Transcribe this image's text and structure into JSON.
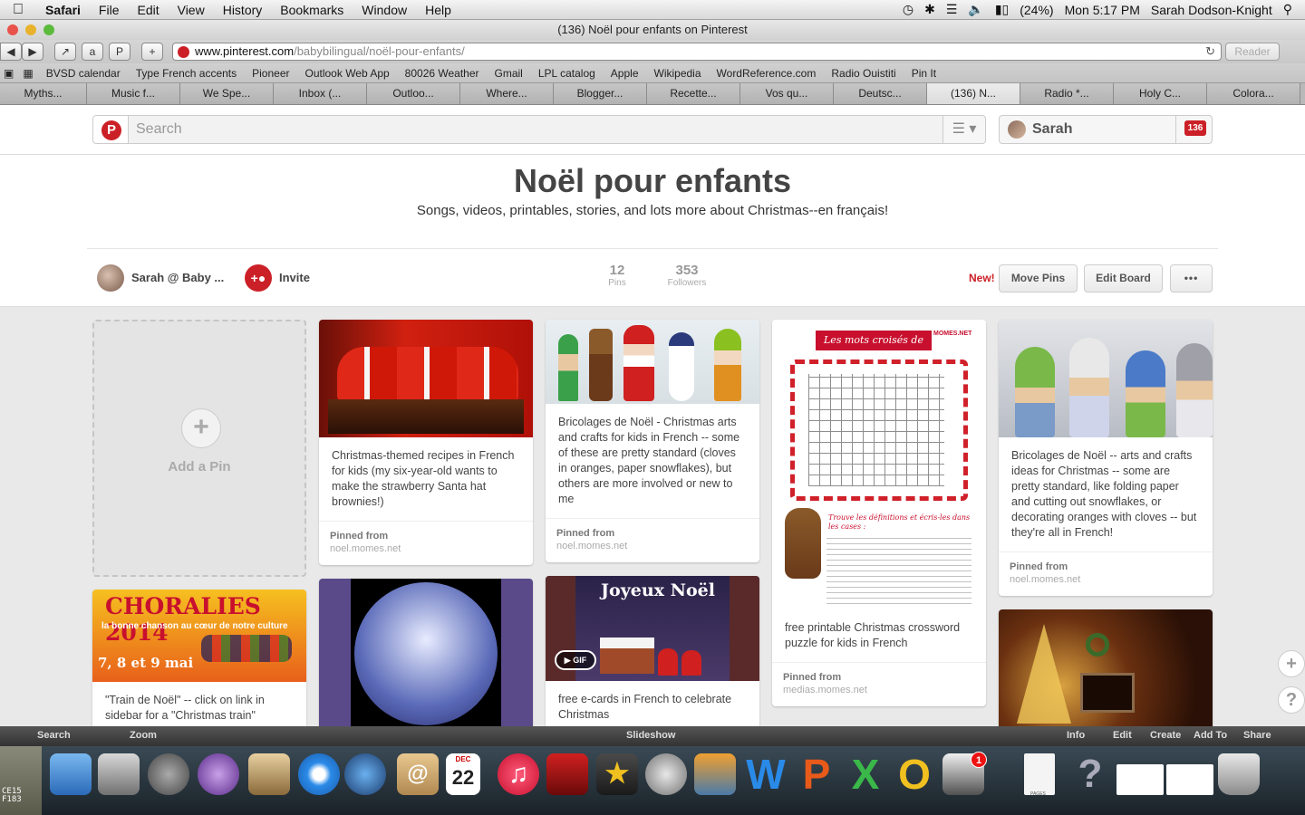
{
  "menubar": {
    "app": "Safari",
    "items": [
      "File",
      "Edit",
      "View",
      "History",
      "Bookmarks",
      "Window",
      "Help"
    ],
    "battery": "(24%)",
    "clock": "Mon 5:17 PM",
    "user": "Sarah Dodson-Knight"
  },
  "window": {
    "title": "(136) Noël pour enfants on Pinterest"
  },
  "toolbar": {
    "url_host": "www.pinterest.com",
    "url_path": "/babybilingual/noël-pour-enfants/",
    "reader": "Reader"
  },
  "bookmarks": [
    "BVSD calendar",
    "Type French accents",
    "Pioneer",
    "Outlook Web App",
    "80026 Weather",
    "Gmail",
    "LPL catalog",
    "Apple",
    "Wikipedia",
    "WordReference.com",
    "Radio Ouistiti",
    "Pin It"
  ],
  "tabs": [
    "Myths...",
    "Music f...",
    "We Spe...",
    "Inbox (...",
    "Outloo...",
    "Where...",
    "Blogger...",
    "Recette...",
    "Vos qu...",
    "Deutsc...",
    "(136) N...",
    "Radio *...",
    "Holy C...",
    "Colora..."
  ],
  "pinterest": {
    "logo": "P",
    "search_placeholder": "Search",
    "menu_icon": "☰ ▾",
    "user_name": "Sarah",
    "notifications": "136"
  },
  "board": {
    "title": "Noël pour enfants",
    "description": "Songs, videos, printables, stories, and lots more about Christmas--en français!",
    "owner": "Sarah @ Baby ...",
    "invite": "Invite",
    "pins_count": "12",
    "pins_label": "Pins",
    "followers_count": "353",
    "followers_label": "Followers",
    "new_label": "New!",
    "move_pins": "Move Pins",
    "edit_board": "Edit Board",
    "more": "•••"
  },
  "add_pin": {
    "label": "Add a Pin",
    "plus": "+"
  },
  "pins": [
    {
      "desc": "Christmas-themed recipes in French for kids (my six-year-old wants to make the strawberry Santa hat brownies!)",
      "pinned": "Pinned from",
      "source": "noel.momes.net"
    },
    {
      "desc": "Bricolages de Noël - Christmas arts and crafts for kids in French -- some of these are pretty standard (cloves in oranges, paper snowflakes), but others are more involved or new to me",
      "pinned": "Pinned from",
      "source": "noel.momes.net"
    },
    {
      "desc": "free printable Christmas crossword puzzle for kids in French",
      "pinned": "Pinned from",
      "source": "medias.momes.net",
      "image_title": "Les mots croisés de Noël",
      "image_brand": "MOMES.NET",
      "image_subtitle": "Trouve les définitions et écris-les dans les cases :"
    },
    {
      "desc": "Bricolages de Noël -- arts and crafts ideas for Christmas -- some are pretty standard, like folding paper and cutting out snowflakes, or decorating oranges with cloves -- but they're all in French!",
      "pinned": "Pinned from",
      "source": "noel.momes.net"
    },
    {
      "desc": "\"Train de Noël\" -- click on link in sidebar for a \"Christmas train\"",
      "image_title": "CHORALIES 2014",
      "image_sub": "la bonne chanson au cœur de notre culture",
      "image_dates": "7, 8 et 9 mai"
    },
    {
      "desc": ""
    },
    {
      "desc": "free e-cards in French to celebrate Christmas",
      "image_title": "Joyeux Noël",
      "gif": "GIF"
    },
    {
      "desc": ""
    }
  ],
  "side_buttons": {
    "plus": "+",
    "help": "?"
  },
  "photo_bar": [
    "Search",
    "Zoom",
    "Slideshow",
    "Info",
    "Edit",
    "Create",
    "Add To",
    "Share"
  ],
  "dock": {
    "calendar_month": "DEC",
    "calendar_day": "22",
    "mail_badge": "1",
    "pages_label": "PAGES"
  },
  "corner": [
    "CE15",
    "F183"
  ]
}
